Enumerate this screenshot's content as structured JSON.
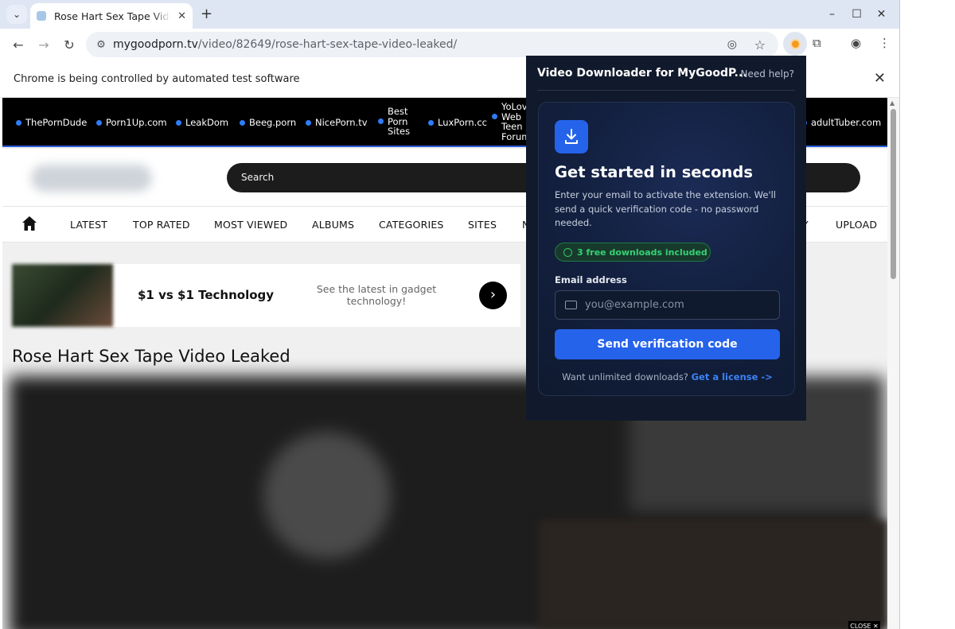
{
  "browser": {
    "tab_title": "Rose Hart Sex Tape Video Leaked",
    "new_tab": "+",
    "url_host": "mygoodporn.tv",
    "url_path": "/video/82649/rose-hart-sex-tape-video-leaked/",
    "automation_message": "Chrome is being controlled by automated test software"
  },
  "site": {
    "partner_links": [
      {
        "label": "ThePornDude",
        "lines": [
          "ThePornDude"
        ]
      },
      {
        "label": "Porn1Up.com",
        "lines": [
          "Porn1Up.com"
        ]
      },
      {
        "label": "LeakDom",
        "lines": [
          "LeakDom"
        ]
      },
      {
        "label": "Beeg.porn",
        "lines": [
          "Beeg.porn"
        ]
      },
      {
        "label": "NicePorn.tv",
        "lines": [
          "NicePorn.tv"
        ]
      },
      {
        "label": "Best Porn Sites",
        "lines": [
          "Best",
          "Porn",
          "Sites"
        ]
      },
      {
        "label": "LuxPorn.cc",
        "lines": [
          "LuxPorn.cc"
        ]
      },
      {
        "label": "YoLove Web Teen Forum",
        "lines": [
          "YoLove",
          "Web",
          "Teen",
          "Forum"
        ]
      },
      {
        "label": "adultTuber.com",
        "lines": [
          "adultTuber.com"
        ]
      }
    ],
    "search_placeholder": "Search",
    "menu": [
      "LATEST",
      "TOP RATED",
      "MOST VIEWED",
      "ALBUMS",
      "CATEGORIES",
      "SITES",
      "N",
      "Y",
      "UPLOAD"
    ],
    "ad": {
      "headline": "$1 vs $1 Technology",
      "subtext": "See the latest in gadget technology!",
      "arrow": "›"
    },
    "video_title": "Rose Hart Sex Tape Video Leaked",
    "close_ad": "CLOSE ✕"
  },
  "popup": {
    "header": "Video Downloader for MyGoodP...",
    "help": "Need help?",
    "title": "Get started in seconds",
    "description": "Enter your email to activate the extension. We'll send a quick verification code - no password needed.",
    "badge": "3 free downloads included",
    "email_label": "Email address",
    "email_placeholder": "you@example.com",
    "send_button": "Send verification code",
    "footer_text": "Want unlimited downloads?",
    "footer_link": "Get a license ->"
  },
  "colors": {
    "accent": "#2563eb",
    "badge_green": "#36d175",
    "popup_bg": "#111a2c",
    "link_dot": "#2f7cf6"
  }
}
